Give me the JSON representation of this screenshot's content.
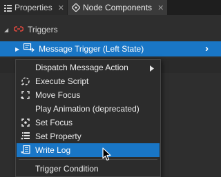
{
  "tabs": [
    {
      "label": "Properties",
      "icon": "properties-icon",
      "close": "✕"
    },
    {
      "label": "Node Components",
      "icon": "node-components-icon",
      "close": "✕"
    }
  ],
  "tree": {
    "root_label": "Triggers",
    "root_icon": "trigger-link-icon",
    "selected_label": "Message Trigger (Left State)",
    "selected_icon": "message-trigger-icon"
  },
  "context_menu": {
    "items": [
      {
        "label": "Dispatch Message Action",
        "icon": "",
        "has_submenu": true
      },
      {
        "label": "Execute Script",
        "icon": "execute-script-icon"
      },
      {
        "label": "Move Focus",
        "icon": "move-focus-icon"
      },
      {
        "label": "Play Animation (deprecated)",
        "icon": ""
      },
      {
        "label": "Set Focus",
        "icon": "set-focus-icon"
      },
      {
        "label": "Set Property",
        "icon": "set-property-icon"
      },
      {
        "label": "Write Log",
        "icon": "write-log-icon",
        "hovered": true
      }
    ],
    "footer_item": {
      "label": "Trigger Condition"
    }
  },
  "colors": {
    "selection": "#1976c6",
    "background": "#2e2e2e",
    "tabbar": "#1e1e1e",
    "trigger_icon": "#e0483e"
  }
}
